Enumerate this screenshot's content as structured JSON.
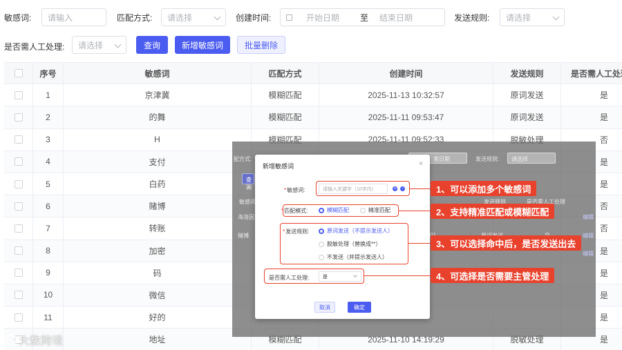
{
  "filters": {
    "keyword_label": "敏感词:",
    "keyword_placeholder": "请输入",
    "match_label": "匹配方式:",
    "match_placeholder": "请选择",
    "created_label": "创建时间:",
    "start_placeholder": "开始日期",
    "to_text": "至",
    "end_placeholder": "结束日期",
    "rule_label": "发送规则:",
    "rule_placeholder": "请选择",
    "manual_label": "是否需人工处理:",
    "manual_placeholder": "请选择",
    "query_button": "查询",
    "add_button": "新增敏感词",
    "batch_delete_button": "批量删除"
  },
  "table": {
    "headers": [
      "序号",
      "敏感词",
      "匹配方式",
      "创建时间",
      "发送规则",
      "是否需人工处理"
    ],
    "rows": [
      {
        "no": "1",
        "word": "京津冀",
        "match": "模糊匹配",
        "time": "2025-11-13 10:32:57",
        "rule": "原词发送",
        "manual": "是"
      },
      {
        "no": "2",
        "word": "的舞",
        "match": "模糊匹配",
        "time": "2025-11-11 09:53:47",
        "rule": "原词发送",
        "manual": "是"
      },
      {
        "no": "3",
        "word": "H",
        "match": "模糊匹配",
        "time": "2025-11-11 09:52:33",
        "rule": "脱敏处理",
        "manual": "否"
      },
      {
        "no": "4",
        "word": "支付",
        "match": "",
        "time": "",
        "rule": "",
        "manual": "是"
      },
      {
        "no": "5",
        "word": "白药",
        "match": "",
        "time": "",
        "rule": "",
        "manual": "是"
      },
      {
        "no": "6",
        "word": "赌博",
        "match": "",
        "time": "",
        "rule": "",
        "manual": "否"
      },
      {
        "no": "7",
        "word": "转账",
        "match": "",
        "time": "",
        "rule": "",
        "manual": "否"
      },
      {
        "no": "8",
        "word": "加密",
        "match": "",
        "time": "",
        "rule": "",
        "manual": "是"
      },
      {
        "no": "9",
        "word": "码",
        "match": "",
        "time": "",
        "rule": "",
        "manual": "是"
      },
      {
        "no": "10",
        "word": "微信",
        "match": "",
        "time": "",
        "rule": "",
        "manual": "是"
      },
      {
        "no": "11",
        "word": "好的",
        "match": "",
        "time": "",
        "rule": "",
        "manual": "是"
      },
      {
        "no": "",
        "word": "地址",
        "match": "模糊匹配",
        "time": "2025-11-10 14:19:29",
        "rule": "脱敏处理",
        "manual": "是"
      }
    ]
  },
  "overlay_bg": {
    "match_label": "配方式:",
    "date_placeholder": "束日期",
    "rule_label": "发送规则:",
    "rule_placeholder": "请选择",
    "query_button": "查询",
    "word_header": "敏感词",
    "rule_header": "发送规则",
    "manual_header": "是否需人工处理",
    "sea_text": "海洛因",
    "edit1": "编辑",
    "rule_val": "原词发送",
    "manual_val": "是",
    "edit2": "编辑",
    "flower_text": "赌博",
    "edit3": "编辑",
    "num_text": "01"
  },
  "dialog": {
    "title": "新增敏感词",
    "close": "×",
    "word_label": "敏感词:",
    "word_placeholder": "请输入关键字（10字内）",
    "match_label": "匹配模式:",
    "match_fuzzy": "模糊匹配",
    "match_exact": "精准匹配",
    "rule_label": "发送规则:",
    "rule_opt1": "原词发送（不提示发送人）",
    "rule_opt2": "脱敏处理（替换成**）",
    "rule_opt3": "不发送（并提示发送人）",
    "manual_label": "是否需人工处理:",
    "manual_value": "是",
    "cancel_button": "取消",
    "confirm_button": "确定"
  },
  "callouts": [
    "1、可以添加多个敏感词",
    "2、支持精准匹配或模糊匹配",
    "3、可以选择命中后，是否发送出去",
    "4、可选择是否需要主管处理"
  ],
  "watermark": "大数跨境",
  "colors": {
    "primary": "#4b5cf0",
    "annotation": "#e8412c"
  }
}
